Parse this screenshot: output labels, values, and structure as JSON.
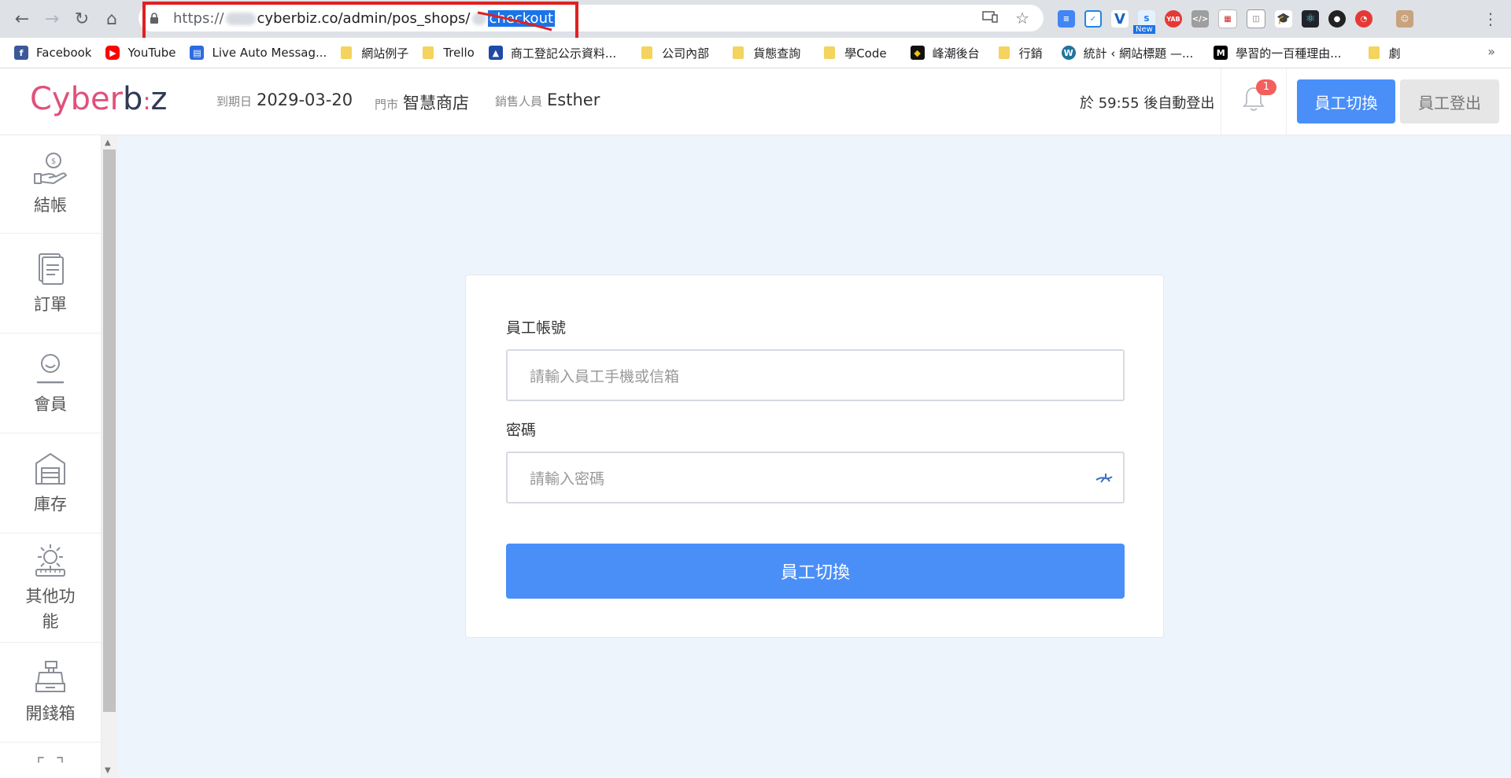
{
  "browser": {
    "url_prefix": "https://",
    "url_host": "cyberbiz.co/admin/pos_shops/",
    "url_selected": "checkout",
    "extension_new_badge": "New",
    "extension_yab_label": "YAB"
  },
  "bookmarks": [
    {
      "label": "Facebook",
      "icon": "facebook-icon",
      "color": "#3b5998"
    },
    {
      "label": "YouTube",
      "icon": "youtube-icon",
      "color": "#ff0000"
    },
    {
      "label": "Live Auto Messag...",
      "icon": "chat-icon",
      "color": "#2d6cdf"
    },
    {
      "label": "網站例子",
      "icon": "folder-icon"
    },
    {
      "label": "Trello",
      "icon": "folder-icon"
    },
    {
      "label": "商工登記公示資料...",
      "icon": "moea-icon",
      "color": "#1f4aa8"
    },
    {
      "label": "公司內部",
      "icon": "folder-icon"
    },
    {
      "label": "貨態查詢",
      "icon": "folder-icon"
    },
    {
      "label": "學Code",
      "icon": "folder-icon"
    },
    {
      "label": "峰潮後台",
      "icon": "black-yellow-icon",
      "color": "#111"
    },
    {
      "label": "行銷",
      "icon": "folder-icon"
    },
    {
      "label": "統計 ‹ 網站標題 —...",
      "icon": "wordpress-icon",
      "color": "#21759b"
    },
    {
      "label": "學習的一百種理由...",
      "icon": "medium-icon",
      "color": "#000"
    },
    {
      "label": "劇",
      "icon": "folder-icon"
    }
  ],
  "header": {
    "logo": {
      "pre": "Cyber",
      "b": "b",
      "post": "z"
    },
    "expiry_label": "到期日",
    "expiry_value": "2029-03-20",
    "store_label": "門市",
    "store_value": "智慧商店",
    "staff_label": "銷售人員",
    "staff_value": "Esther",
    "auto_logout": "於 59:55 後自動登出",
    "notification_count": "1",
    "switch_button": "員工切換",
    "logout_button": "員工登出"
  },
  "sidebar": {
    "items": [
      {
        "label": "結帳",
        "icon": "checkout-hand-coin-icon"
      },
      {
        "label": "訂單",
        "icon": "order-document-icon"
      },
      {
        "label": "會員",
        "icon": "member-user-icon"
      },
      {
        "label": "庫存",
        "icon": "warehouse-icon"
      },
      {
        "label": "其他功能",
        "icon": "settings-tools-icon"
      },
      {
        "label": "開錢箱",
        "icon": "cash-register-icon"
      }
    ]
  },
  "login": {
    "account_label": "員工帳號",
    "account_placeholder": "請輸入員工手機或信箱",
    "password_label": "密碼",
    "password_placeholder": "請輸入密碼",
    "submit_label": "員工切換"
  },
  "colors": {
    "primary": "#4a8ff8",
    "brand_pink": "#e0507a",
    "badge_red": "#f25f5c",
    "page_bg": "#eef4fc"
  }
}
